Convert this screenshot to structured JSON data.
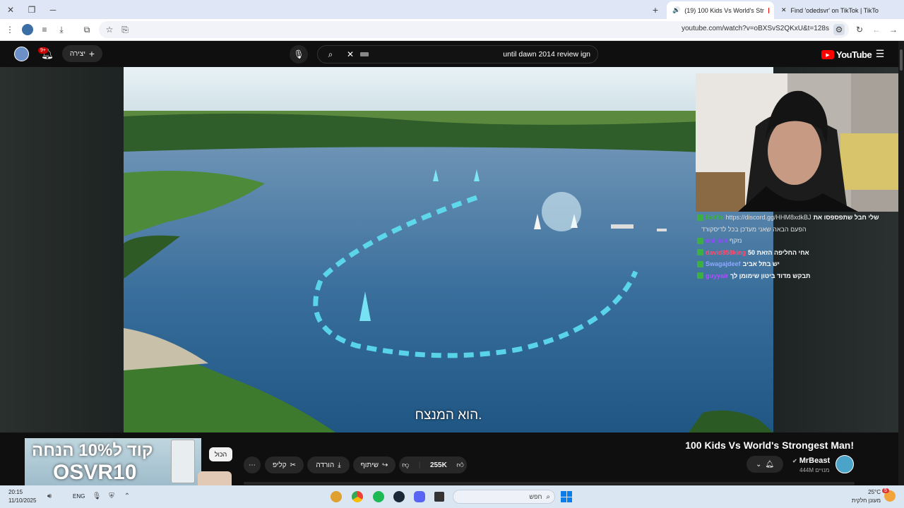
{
  "browser": {
    "tabs": [
      {
        "label": "(19) 100 Kids Vs World's Str",
        "active": true
      },
      {
        "label": "Find 'odedsvr' on TikTok | TikTo",
        "active": false
      }
    ],
    "url": "youtube.com/watch?v=oBXSvS2QKxU&t=128s"
  },
  "youtube": {
    "brand": "YouTube",
    "create_label": "יצירה",
    "notif_badge": "9+",
    "search_query": "until dawn 2014 review ign"
  },
  "video": {
    "subtitle": "הוא המנצח.",
    "title": "100 Kids Vs World's Strongest Man!",
    "channel": "MrBeast",
    "subscribers": "444M מנויים",
    "likes": "255K",
    "share_label": "שיתוף",
    "download_label": "הורדה",
    "clip_label": "קליפ",
    "all_label": "הכול"
  },
  "ad": {
    "line1": "קוד ל10% הנחה",
    "line2": "OSVR10"
  },
  "chat": [
    {
      "user": "Botfix",
      "text": "https://discord.gg/HHM8xdkBJ",
      "prefix": "שלי חבל שתפספסו את",
      "color": "#3cb043"
    },
    {
      "user": "",
      "text": "הפעם הבאה שאני מעדכן בכל לדיסקורד",
      "prefix": "",
      "color": "#ccc"
    },
    {
      "user": "ani_ish",
      "text": "נזקף",
      "prefix": "",
      "color": "#9147ff"
    },
    {
      "user": "david858king",
      "text": "אחי החליפה הזאת 50",
      "prefix": "",
      "color": "#ff4d6d"
    },
    {
      "user": "Swagajdeef",
      "text": "יש בתל אביב",
      "prefix": "",
      "color": "#8fa8ff"
    },
    {
      "user": "guyyair",
      "text": "תבקש מדוד ביטון שימומן לך",
      "prefix": "",
      "color": "#b04dff"
    }
  ],
  "taskbar": {
    "search_placeholder": "חפש",
    "lang": "ENG",
    "time": "20:15",
    "date": "11/10/2025",
    "weather_temp": "25°C",
    "weather_desc": "מעונן חלקית",
    "weather_badge": "5"
  }
}
